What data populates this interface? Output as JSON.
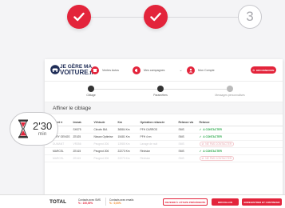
{
  "stepper": {
    "step3_label": "3"
  },
  "header": {
    "logo_line1": "JE GÈRE MA",
    "logo_line2": "VOITURE",
    "logo_suffix": ".fr",
    "agency": "Ventes Autos",
    "campaigns": "Mes campagnes",
    "account": "Mon Compte",
    "logout": "DÉCONNEXION"
  },
  "progress": {
    "steps": [
      "Ciblage",
      "Paramètres",
      "Messages personnalisés"
    ]
  },
  "panel_title": "Affiner le ciblage",
  "table": {
    "headers": [
      "Client ▾",
      "Immat.",
      "Véhicule",
      "Km",
      "Opération relancée",
      "Relance via",
      "Relance"
    ],
    "rows": [
      {
        "client": "FIAT",
        "immat": "SH375",
        "vehicule": "Citroën BIA",
        "km": "36584 Km",
        "op": "PFH CARROS",
        "via": "SMS",
        "relance": "A CONTACTER",
        "state": "ok"
      },
      {
        "client": "ZERY OENGS",
        "immat": "ZE425",
        "vehicule": "Nissan Optimise",
        "km": "15481 Km",
        "op": "PFH 4 en",
        "via": "SMS",
        "relance": "A CONTACTER",
        "state": "ok"
      },
      {
        "client": "DUMANT",
        "immat": "VR356",
        "vehicule": "Peugeot 206",
        "km": "13985 Km",
        "op": "Lavage de nuit",
        "via": "SMS",
        "relance": "NE PAS CONTACTER",
        "state": "no"
      },
      {
        "client": "MARCEL",
        "immat": "ZE415",
        "vehicule": "Peugeot 206",
        "km": "22273 Km",
        "op": "Révision",
        "via": "SMS",
        "relance": "A CONTACTER",
        "state": "ok"
      },
      {
        "client": "MARCEL",
        "immat": "ZE415",
        "vehicule": "Peugeot 206",
        "km": "22273 Km",
        "op": "Révision",
        "via": "SMS",
        "relance": "NE PAS CONTACTER",
        "state": "no"
      }
    ]
  },
  "footer": {
    "total": "TOTAL",
    "sms_label": "Contacts avec SMS",
    "sms_value": "% : 100,00%",
    "email_label": "Contacts avec emails",
    "email_value": "% : 0,00%",
    "prev": "REVENIR À L'ÉTAPE PRÉCÉDENTE",
    "draft": "BROUILLON",
    "save": "ENREGISTRER ET CONTINUER"
  },
  "timer": {
    "value": "2'30",
    "unit": "min"
  },
  "colors": {
    "accent": "#e3243b",
    "ok": "#2aa84a"
  }
}
